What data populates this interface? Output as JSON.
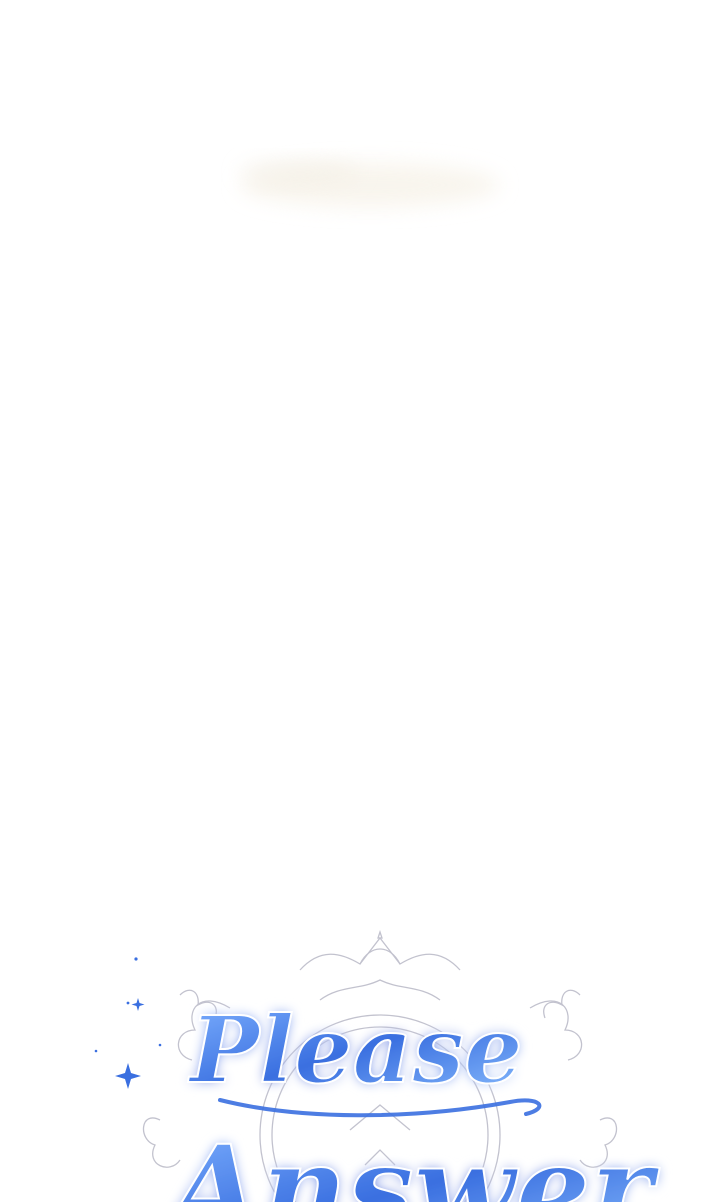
{
  "panel": {
    "title_logo": {
      "line1": "Please",
      "line2": "Answer",
      "colors": {
        "primary_blue": "#3a6fe0",
        "light_blue": "#7fb2ff",
        "glow_purple": "#b9a5ff",
        "ornament_gray": "#b8b8c6"
      }
    },
    "background_color": "#ffffff"
  }
}
